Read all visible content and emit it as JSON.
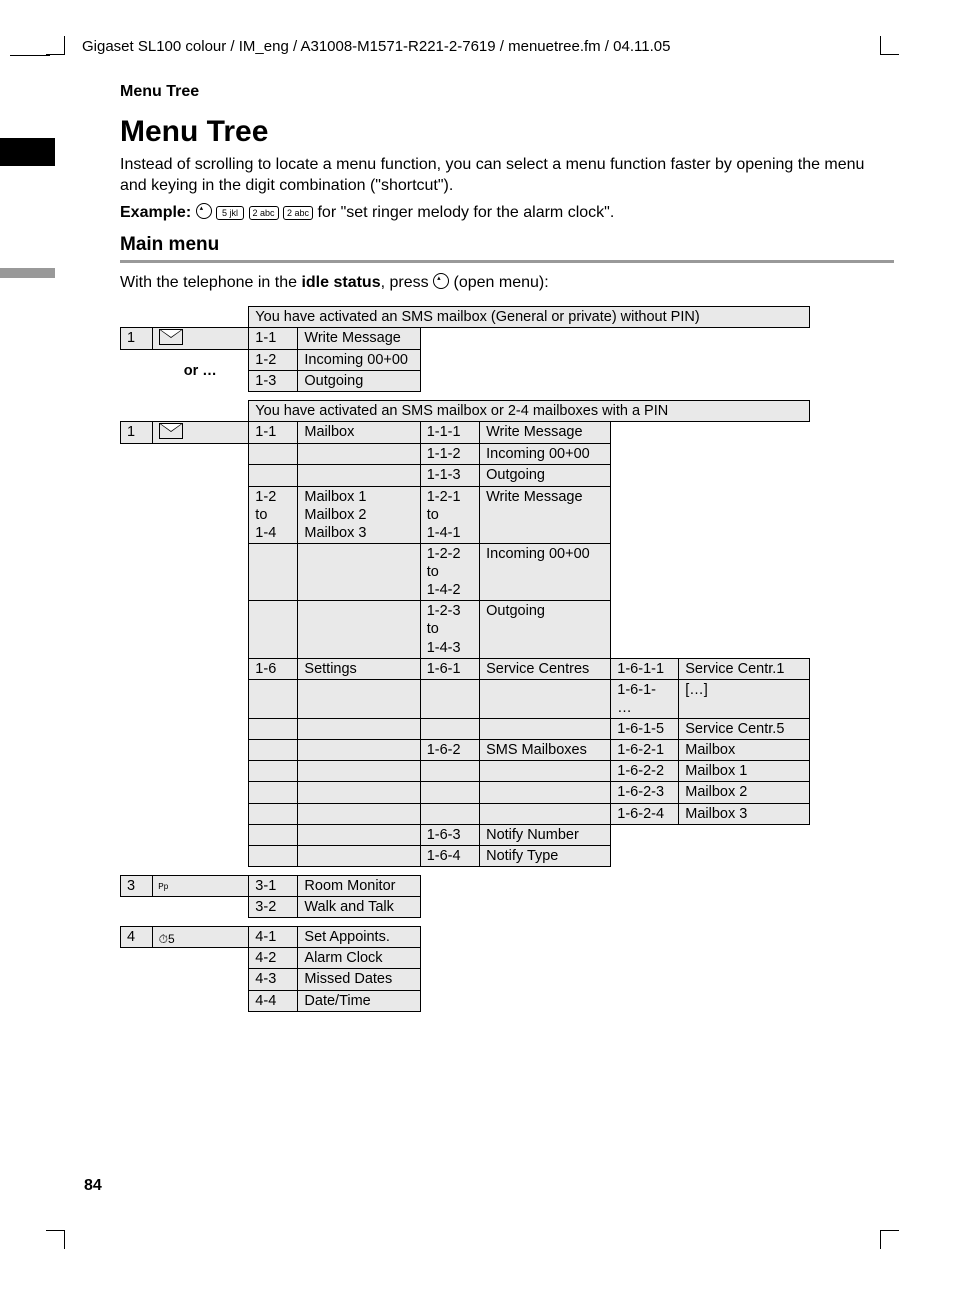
{
  "header": "Gigaset SL100 colour / IM_eng / A31008-M1571-R221-2-7619 / menuetree.fm / 04.11.05",
  "section_label": "Menu Tree",
  "title": "Menu Tree",
  "intro": "Instead of scrolling to locate a menu function, you can select a menu function faster by opening the menu and keying in the digit combination (\"shortcut\").",
  "example_label": "Example:",
  "example_keys": [
    "5 jkl",
    "2 abc",
    "2 abc"
  ],
  "example_tail": " for \"set ringer melody for the alarm clock\".",
  "subheading": "Main menu",
  "idle_pre": "With the telephone in the ",
  "idle_bold": "idle status",
  "idle_post": ", press ",
  "idle_tail": " (open menu):",
  "banner1": "You have activated an SMS mailbox (General or private) without PIN)",
  "banner2": "You have activated an SMS mailbox or 2-4 mailboxes with a PIN",
  "or_text": "or …",
  "rows_a": [
    {
      "idx": "1",
      "c2": "1-1",
      "c3": "Write Message"
    },
    {
      "c2": "1-2",
      "c3": "Incoming 00+00"
    },
    {
      "c2": "1-3",
      "c3": "Outgoing"
    }
  ],
  "rows_b": [
    {
      "idx": "1",
      "c2": "1-1",
      "c3": "Mailbox",
      "c4": "1-1-1",
      "c5": "Write Message"
    },
    {
      "c4": "1-1-2",
      "c5": "Incoming 00+00"
    },
    {
      "c4": "1-1-3",
      "c5": "Outgoing"
    },
    {
      "c2": "1-2\nto\n1-4",
      "c3": "Mailbox 1\nMailbox 2\nMailbox 3",
      "c4": "1-2-1\nto\n1-4-1",
      "c5": "Write Message"
    },
    {
      "c4": "1-2-2\nto\n1-4-2",
      "c5": "Incoming 00+00"
    },
    {
      "c4": "1-2-3\nto\n1-4-3",
      "c5": "Outgoing"
    },
    {
      "c2": "1-6",
      "c3": "Settings",
      "c4": "1-6-1",
      "c5": "Service Centres",
      "c6": "1-6-1-1",
      "c7": "Service Centr.1"
    },
    {
      "c6": "1-6-1-\n…",
      "c7": "[…]"
    },
    {
      "c6": "1-6-1-5",
      "c7": "Service Centr.5"
    },
    {
      "c4": "1-6-2",
      "c5": "SMS Mailboxes",
      "c6": "1-6-2-1",
      "c7": "Mailbox"
    },
    {
      "c6": "1-6-2-2",
      "c7": "Mailbox 1"
    },
    {
      "c6": "1-6-2-3",
      "c7": "Mailbox 2"
    },
    {
      "c6": "1-6-2-4",
      "c7": "Mailbox 3"
    },
    {
      "c4": "1-6-3",
      "c5": "Notify Number"
    },
    {
      "c4": "1-6-4",
      "c5": "Notify Type"
    }
  ],
  "rows_c": [
    {
      "idx": "3",
      "icon": "baby",
      "c2": "3-1",
      "c3": "Room Monitor"
    },
    {
      "c2": "3-2",
      "c3": "Walk and Talk"
    }
  ],
  "rows_d": [
    {
      "idx": "4",
      "icon": "clock",
      "c2": "4-1",
      "c3": "Set Appoints."
    },
    {
      "c2": "4-2",
      "c3": "Alarm Clock"
    },
    {
      "c2": "4-3",
      "c3": "Missed Dates"
    },
    {
      "c2": "4-4",
      "c3": "Date/Time"
    }
  ],
  "page_number": "84"
}
